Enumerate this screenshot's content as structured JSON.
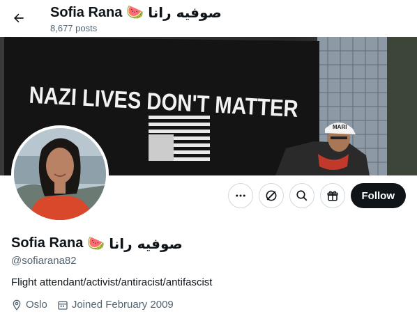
{
  "header": {
    "display_name": "Sofia Rana",
    "emoji": "🍉",
    "arabic_name": "صوفيه رانا",
    "post_count": "8,677 posts"
  },
  "banner": {
    "sign_text": "NAZI LIVES DON'T MATTER",
    "cap_text": "MARI"
  },
  "actions": {
    "follow_label": "Follow",
    "icons": [
      "more-icon",
      "grok-icon",
      "search-icon",
      "gift-icon"
    ]
  },
  "profile": {
    "display_name": "Sofia Rana",
    "emoji": "🍉",
    "arabic_name": "صوفيه رانا",
    "handle": "@sofiarana82",
    "bio": "Flight attendant/activist/antiracist/antifascist",
    "location": "Oslo",
    "joined": "Joined February 2009"
  },
  "colors": {
    "text": "#0f1419",
    "secondary": "#536471",
    "follow_bg": "#0f1419",
    "border": "#cfd9de"
  }
}
